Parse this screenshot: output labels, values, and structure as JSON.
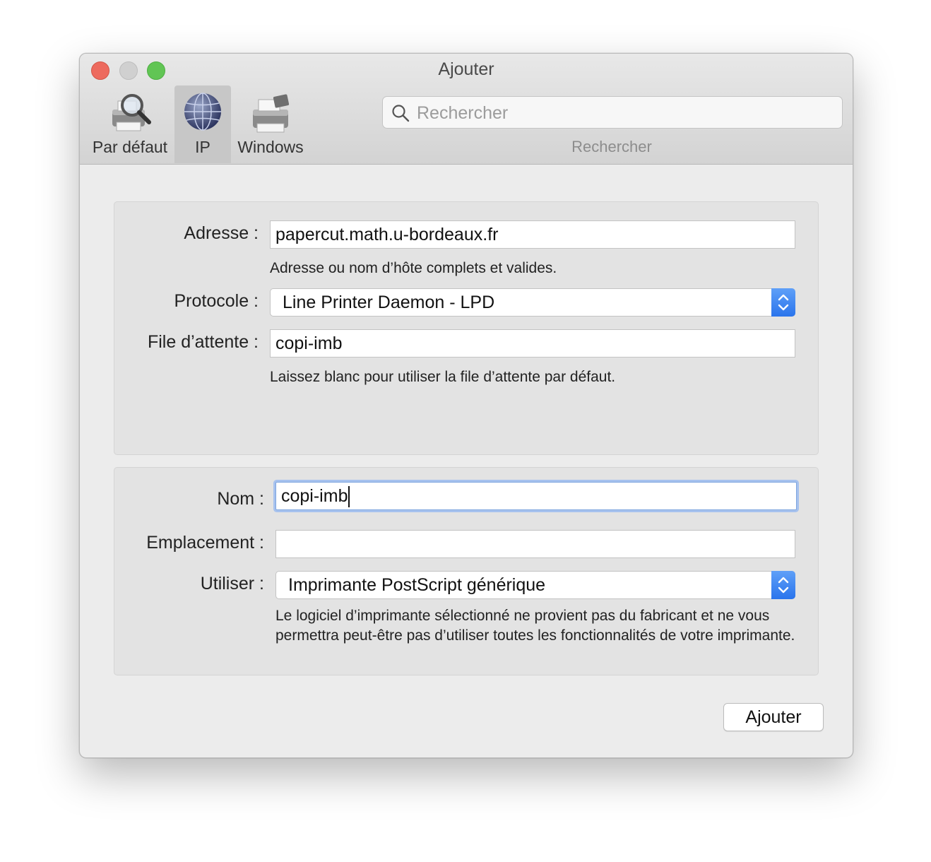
{
  "window": {
    "title": "Ajouter"
  },
  "toolbar": {
    "items": [
      {
        "label": "Par défaut"
      },
      {
        "label": "IP"
      },
      {
        "label": "Windows"
      }
    ],
    "search": {
      "placeholder": "Rechercher",
      "value": "",
      "label": "Rechercher"
    }
  },
  "connection": {
    "address_label": "Adresse :",
    "address_value": "papercut.math.u-bordeaux.fr",
    "address_hint": "Adresse ou nom d’hôte complets et valides.",
    "protocol_label": "Protocole :",
    "protocol_value": "Line Printer Daemon - LPD",
    "queue_label": "File d’attente :",
    "queue_value": "copi-imb",
    "queue_hint": "Laissez blanc pour utiliser la file d’attente par défaut."
  },
  "printer": {
    "name_label": "Nom :",
    "name_value": "copi-imb",
    "location_label": "Emplacement :",
    "location_value": "",
    "use_label": "Utiliser :",
    "use_value": "Imprimante PostScript générique",
    "driver_hint": "Le logiciel d’imprimante sélectionné ne provient pas du fabricant et ne vous permettra peut-être pas d’utiliser toutes les fonctionnalités de votre imprimante."
  },
  "actions": {
    "add_label": "Ajouter"
  },
  "colors": {
    "accent": "#2a74ec",
    "close": "#ed6a5e",
    "zoom": "#61c554"
  }
}
